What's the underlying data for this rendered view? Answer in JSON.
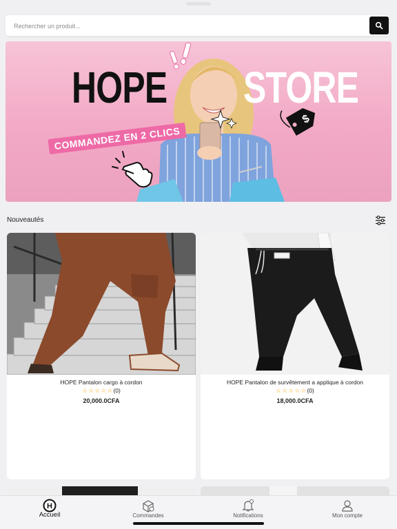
{
  "search": {
    "placeholder": "Rechercher un produit..."
  },
  "banner": {
    "title_left": "HOPE",
    "title_right": "STORE",
    "cta": "COMMANDEZ EN 2 CLICS"
  },
  "section": {
    "title": "Nouveautés"
  },
  "products": [
    {
      "name": "HOPE Pantalon cargo à cordon",
      "stars": "☆☆☆☆☆",
      "reviews": "(0)",
      "price": "20,000.0CFA"
    },
    {
      "name": "HOPE Pantalon de survêtement a applique à cordon",
      "stars": "☆☆☆☆☆",
      "reviews": "(0)",
      "price": "18,000.0CFA"
    }
  ],
  "tabs": [
    {
      "label": "Accueil",
      "icon": "home-h-icon",
      "active": true
    },
    {
      "label": "Commandes",
      "icon": "box-icon",
      "active": false
    },
    {
      "label": "Notifications",
      "icon": "bell-icon",
      "active": false
    },
    {
      "label": "Mon compte",
      "icon": "user-icon",
      "active": false
    }
  ],
  "colors": {
    "accent": "#111111",
    "star": "#f2a413",
    "banner_pink": "#f2a9c5",
    "cta_pink": "#ee6aa6"
  }
}
